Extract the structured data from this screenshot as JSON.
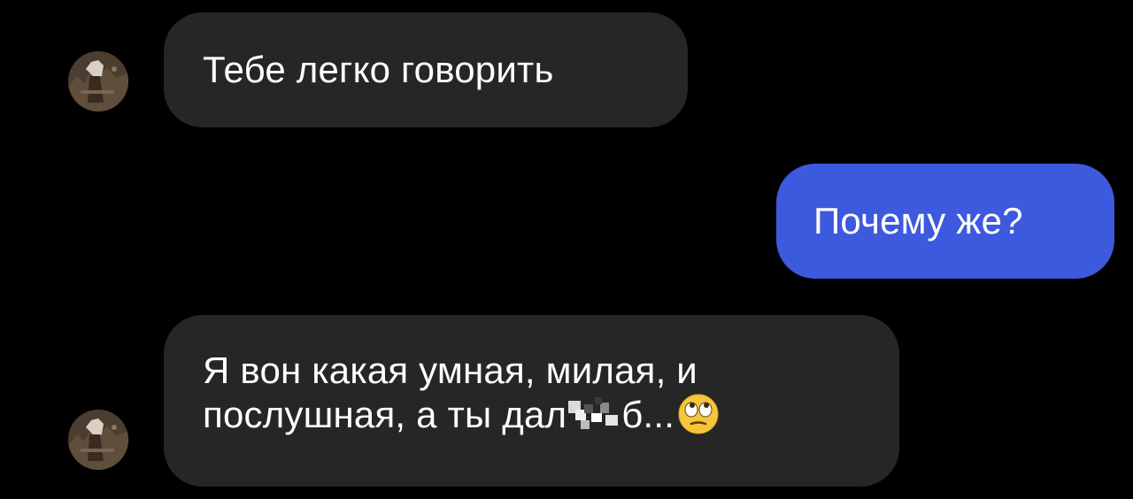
{
  "messages": [
    {
      "id": "msg1",
      "sender": "them",
      "text": "Тебе легко говорить"
    },
    {
      "id": "msg2",
      "sender": "me",
      "text": "Почему же?"
    },
    {
      "id": "msg3",
      "sender": "them",
      "line1": "Я вон какая умная, милая, и",
      "line2_start": "послушная, а ты дал",
      "line2_end": "б...",
      "emoji": "face-with-rolling-eyes"
    }
  ],
  "colors": {
    "background": "#000000",
    "incoming_bubble": "#262626",
    "outgoing_bubble": "#3d59de",
    "text": "#ffffff"
  }
}
